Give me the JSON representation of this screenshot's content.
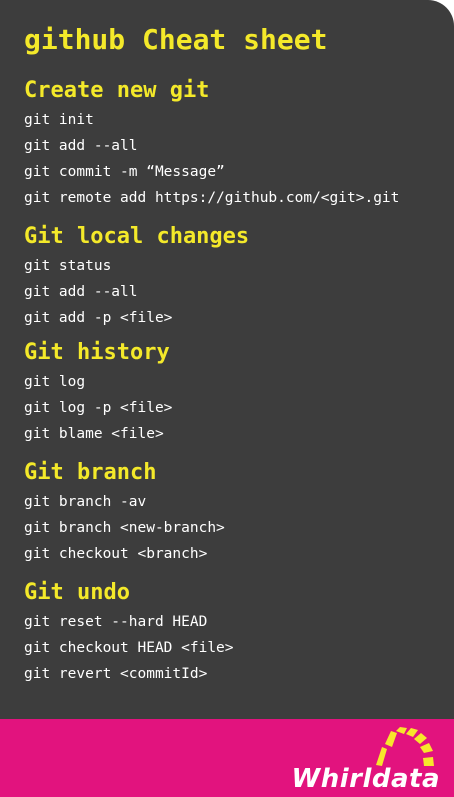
{
  "title": "github Cheat sheet",
  "sections": [
    {
      "heading": "Create new git",
      "commands": [
        "git init",
        "git add --all",
        "git commit -m “Message”",
        "git remote add https://github.com/<git>.git"
      ]
    },
    {
      "heading": "Git local changes",
      "commands": [
        "git status",
        "git add --all",
        "git add -p <file>"
      ]
    },
    {
      "heading": "Git history",
      "commands": [
        "git log",
        "git log -p <file>",
        "git blame <file>"
      ]
    },
    {
      "heading": "Git branch",
      "commands": [
        "git branch -av",
        "git branch <new-branch>",
        "git checkout <branch>"
      ]
    },
    {
      "heading": "Git undo",
      "commands": [
        "git reset --hard HEAD",
        "git checkout HEAD <file>",
        "git revert <commitId>"
      ]
    }
  ],
  "footer": {
    "logo_text": "Whirldata"
  },
  "colors": {
    "background": "#3d3d3d",
    "heading": "#f4e92a",
    "command": "#ffffff",
    "footer": "#e2137e",
    "logo_mark": "#f7e62b"
  }
}
